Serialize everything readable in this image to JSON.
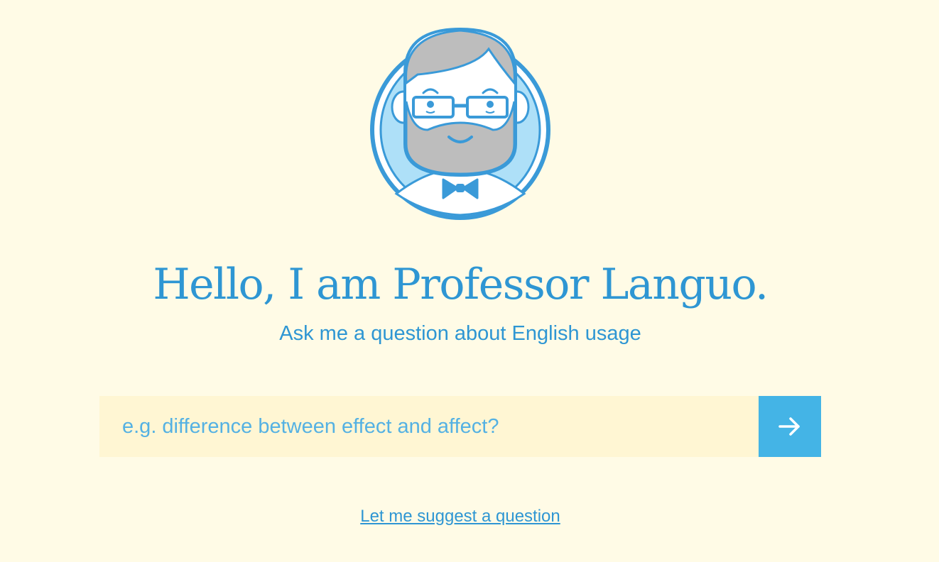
{
  "hero": {
    "avatar_name": "professor-languo-avatar",
    "title": "Hello, I am Professor Languo.",
    "subtitle": "Ask me a question about English usage"
  },
  "search": {
    "placeholder": "e.g. difference between effect and affect?",
    "value": "",
    "submit_icon": "arrow-right-icon"
  },
  "suggest": {
    "label": "Let me suggest a question"
  },
  "colors": {
    "background": "#fffbe6",
    "accent": "#2e96d3",
    "button": "#44b4e6",
    "input_background": "#fff6d3"
  }
}
